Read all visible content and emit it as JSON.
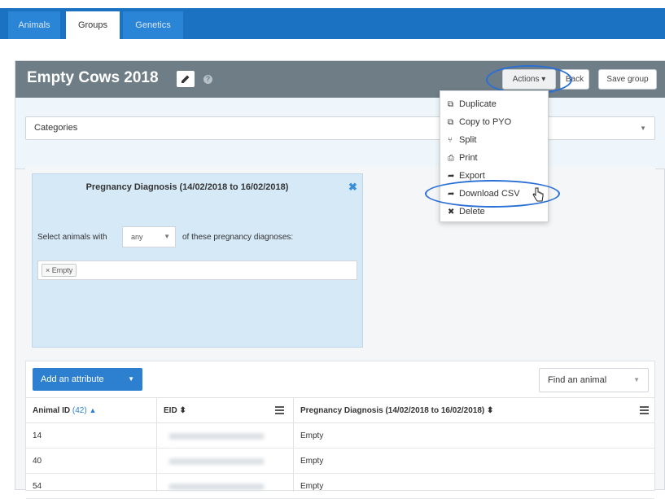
{
  "tabs": [
    {
      "label": "Animals"
    },
    {
      "label": "Groups"
    },
    {
      "label": "Genetics"
    }
  ],
  "group": {
    "title": "Empty Cows 2018",
    "actions_label": "Actions ▾",
    "back_label": "Back",
    "save_label": "Save group"
  },
  "categories": {
    "label": "Categories"
  },
  "criteria": {
    "title": "Pregnancy Diagnosis (14/02/2018 to 16/02/2018)",
    "select_prefix": "Select animals with",
    "select_value": "any",
    "select_suffix": "of these pregnancy diagnoses:",
    "tag": "× Empty"
  },
  "actions_menu": {
    "items": [
      {
        "label": "Duplicate",
        "icon": "copy-icon"
      },
      {
        "label": "Copy to PYO",
        "icon": "copy-icon"
      },
      {
        "label": "Split",
        "icon": "split-icon"
      },
      {
        "label": "Print",
        "icon": "print-icon"
      },
      {
        "label": "Export",
        "icon": "share-icon"
      },
      {
        "label": "Download CSV",
        "icon": "share-icon"
      },
      {
        "label": "Delete",
        "icon": "close-icon"
      }
    ]
  },
  "table": {
    "add_attribute_label": "Add an attribute",
    "find_animal_label": "Find an animal",
    "columns": {
      "animal_id": "Animal ID",
      "animal_count": "(42)",
      "eid": "EID ⬍",
      "pregnancy": "Pregnancy Diagnosis (14/02/2018 to 16/02/2018) ⬍"
    },
    "rows": [
      {
        "animal_id": "14",
        "pregnancy": "Empty"
      },
      {
        "animal_id": "40",
        "pregnancy": "Empty"
      },
      {
        "animal_id": "54",
        "pregnancy": "Empty"
      }
    ]
  },
  "colors": {
    "nav_blue": "#1b72c2",
    "header_gray": "#6f7d86",
    "accent": "#2d80cf",
    "annotation": "#2a6fd6"
  }
}
